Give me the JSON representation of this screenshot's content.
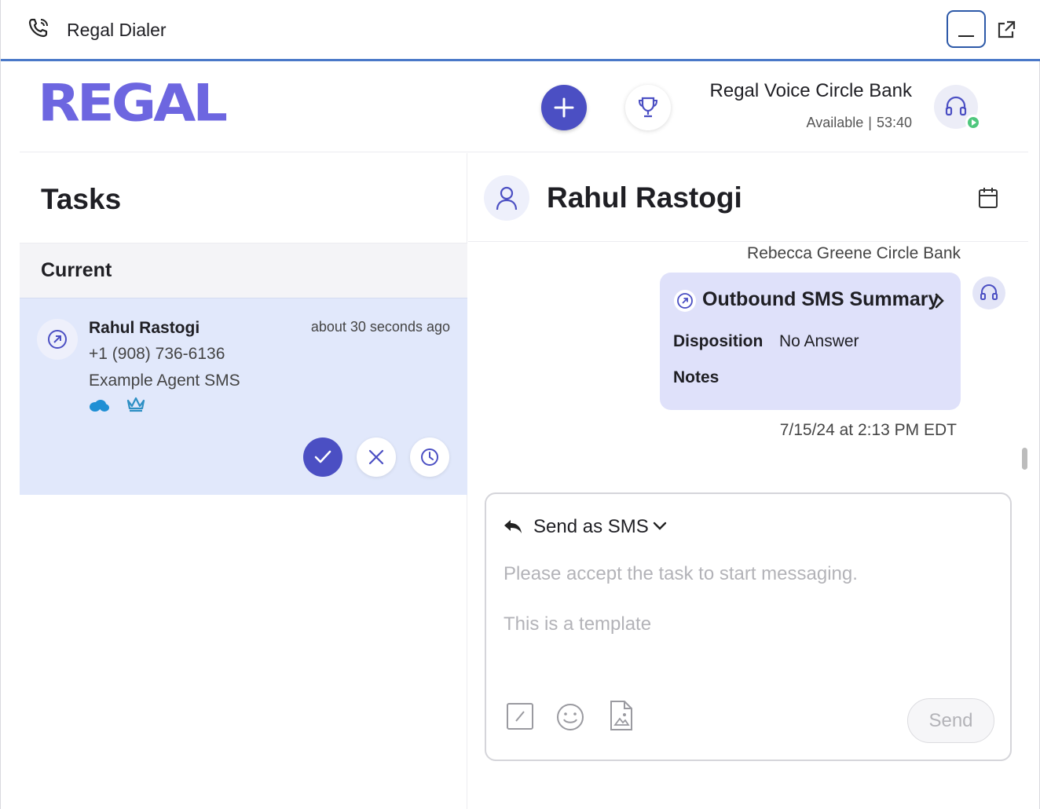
{
  "window": {
    "title": "Regal Dialer",
    "icons": {
      "app": "phone-icon",
      "minimize": "minimize-icon",
      "popout": "popout-icon"
    }
  },
  "header": {
    "logo_text": "REGAL",
    "add_icon": "plus-icon",
    "trophy_icon": "trophy-icon",
    "org_name": "Regal Voice Circle Bank",
    "status": "Available",
    "separator": "|",
    "timer": "53:40",
    "agent_icon": "headset-icon",
    "status_color": "#4fc77d"
  },
  "tasks": {
    "title": "Tasks",
    "section": "Current",
    "items": [
      {
        "name": "Rahul Rastogi",
        "time": "about 30 seconds ago",
        "phone": "+1 (908) 736-6136",
        "campaign": "Example Agent SMS",
        "icons": [
          "outbound-icon",
          "salesforce-icon",
          "crown-icon"
        ],
        "actions": [
          "accept-icon",
          "reject-icon",
          "snooze-icon"
        ]
      }
    ]
  },
  "contact": {
    "name": "Rahul Rastogi",
    "icon": "user-icon",
    "calendar_icon": "calendar-icon"
  },
  "conversation": {
    "sender": "Rebecca Greene Circle Bank",
    "summary": {
      "title": "Outbound SMS Summary",
      "disposition_label": "Disposition",
      "disposition_value": "No Answer",
      "notes_label": "Notes"
    },
    "timestamp": "7/15/24 at 2:13 PM EDT"
  },
  "composer": {
    "mode_label": "Send as SMS",
    "placeholder": "Please accept the task to start messaging.",
    "template_text": "This is a template",
    "send_label": "Send",
    "tool_icons": [
      "slash-command-icon",
      "emoji-icon",
      "attachment-icon"
    ]
  },
  "colors": {
    "brand": "#6d66e0",
    "primary_button": "#4b4fc3",
    "task_highlight": "#e1e8fb",
    "summary_bg": "#dfe1fa",
    "titlebar_accent": "#4a78c8"
  }
}
